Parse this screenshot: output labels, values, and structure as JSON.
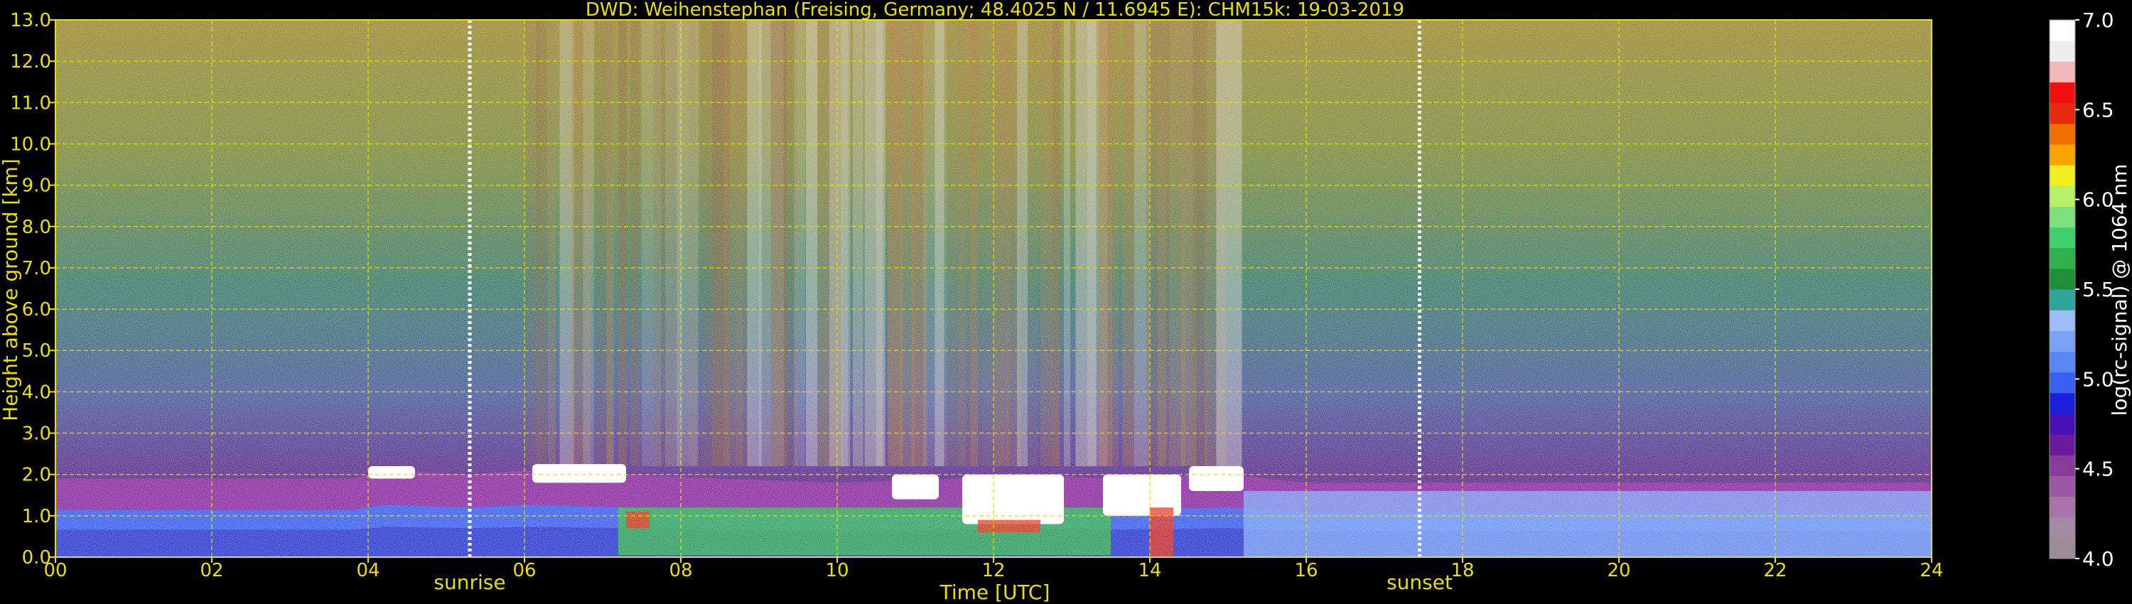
{
  "chart_data": {
    "type": "heatmap",
    "title": "DWD: Weihenstephan (Freising, Germany; 48.4025 N / 11.6945 E):    CHM15k: 19-03-2019",
    "xlabel": "Time [UTC]",
    "ylabel": "Height above ground [km]",
    "xlim": [
      0,
      24
    ],
    "ylim": [
      0,
      13
    ],
    "x_ticks": [
      "00",
      "02",
      "04",
      "06",
      "08",
      "10",
      "12",
      "14",
      "16",
      "18",
      "20",
      "22",
      "24"
    ],
    "y_ticks": [
      "0.0",
      "1.0",
      "2.0",
      "3.0",
      "4.0",
      "5.0",
      "6.0",
      "7.0",
      "8.0",
      "9.0",
      "10.0",
      "11.0",
      "12.0",
      "13.0"
    ],
    "grid": true,
    "markers": [
      {
        "label": "sunrise",
        "x": 5.3
      },
      {
        "label": "sunset",
        "x": 17.45
      }
    ],
    "colorbar": {
      "label": "log(rc-signal) @ 1064 nm",
      "range": [
        4.0,
        7.0
      ],
      "ticks": [
        "4.0",
        "4.5",
        "5.0",
        "5.5",
        "6.0",
        "6.5",
        "7.0"
      ],
      "colors": [
        "#9c8c95",
        "#a38aa2",
        "#a773a8",
        "#9b58a3",
        "#8a3a9b",
        "#6a1a9c",
        "#4a10b8",
        "#1a1fd9",
        "#3a5ef0",
        "#5b85f5",
        "#7aa2f6",
        "#9fbdf8",
        "#2fa59a",
        "#1f8f3a",
        "#2fb04a",
        "#3fd070",
        "#7fe080",
        "#b8f06a",
        "#f0f020",
        "#f7a300",
        "#f07000",
        "#e62a10",
        "#f01010",
        "#f0b8b8",
        "#eeeeee",
        "#ffffff"
      ]
    },
    "boundary_layer_height_km": [
      {
        "x": 0,
        "y": 1.9
      },
      {
        "x": 3.8,
        "y": 1.9
      },
      {
        "x": 4.2,
        "y": 2.1
      },
      {
        "x": 5.3,
        "y": 2.0
      },
      {
        "x": 6.0,
        "y": 2.1
      },
      {
        "x": 7.3,
        "y": 2.0
      },
      {
        "x": 8.5,
        "y": 1.9
      },
      {
        "x": 10.0,
        "y": 1.8
      },
      {
        "x": 11.5,
        "y": 1.9
      },
      {
        "x": 12.5,
        "y": 2.0
      },
      {
        "x": 13.5,
        "y": 1.9
      },
      {
        "x": 15.0,
        "y": 2.0
      },
      {
        "x": 16.0,
        "y": 1.8
      },
      {
        "x": 18.0,
        "y": 1.8
      },
      {
        "x": 21.0,
        "y": 1.8
      },
      {
        "x": 24.0,
        "y": 1.8
      }
    ]
  }
}
